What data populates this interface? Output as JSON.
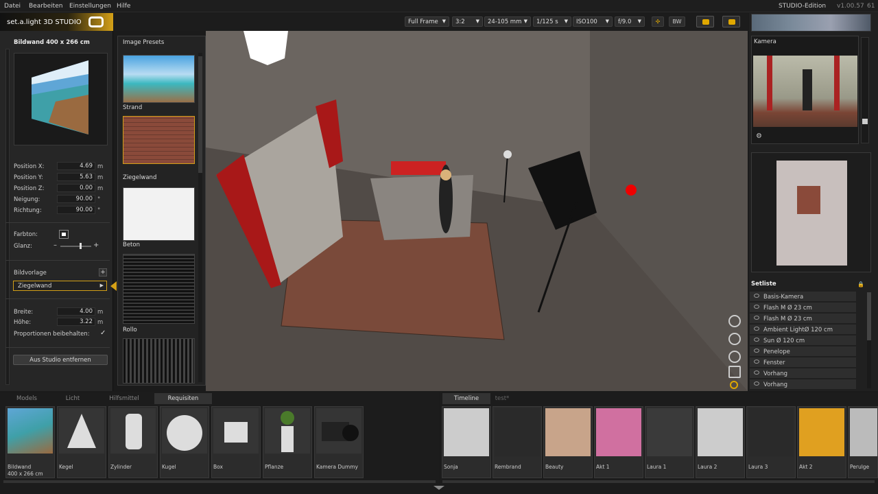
{
  "menu": {
    "items": [
      "Datei",
      "Bearbeiten",
      "Einstellungen",
      "Hilfe"
    ],
    "edition": "STUDIO-Edition",
    "version": "v1.00.57",
    "fps": "61"
  },
  "logo": {
    "text": "set.a.light 3D STUDIO"
  },
  "toolbar": {
    "frame": "Full Frame",
    "ratio": "3:2",
    "lens": "24-105 mm",
    "shutter": "1/125 s",
    "iso": "ISO100",
    "aperture": "f/9.0",
    "bw": "BW"
  },
  "left": {
    "title": "Bildwand 400 x 266 cm",
    "fields": [
      {
        "label": "Position X:",
        "value": "4.69",
        "unit": "m"
      },
      {
        "label": "Position Y:",
        "value": "5.63",
        "unit": "m"
      },
      {
        "label": "Position Z:",
        "value": "0.00",
        "unit": "m"
      },
      {
        "label": "Neigung:",
        "value": "90.00",
        "unit": "°"
      },
      {
        "label": "Richtung:",
        "value": "90.00",
        "unit": "°"
      }
    ],
    "farbton": "Farbton:",
    "glanz": "Glanz:",
    "bildvorlage": "Bildvorlage",
    "bildvorlage_value": "Ziegelwand",
    "breite_label": "Breite:",
    "breite": "4.00",
    "hoehe_label": "Höhe:",
    "hoehe": "3.22",
    "unit": "m",
    "proportionen": "Proportionen beibehalten:",
    "remove": "Aus Studio entfernen"
  },
  "presets": {
    "title": "Image Presets",
    "items": [
      "Strand",
      "Ziegelwand",
      "Beton",
      "Rollo"
    ]
  },
  "right": {
    "kamera": "Kamera",
    "setliste_title": "Setliste",
    "setliste": [
      "Basis-Kamera",
      "Flash M Ø 23 cm",
      "Flash M Ø 23 cm",
      "Ambient LightØ 120 cm",
      "Sun Ø 120 cm",
      "Penelope",
      "Fenster",
      "Vorhang",
      "Vorhang"
    ]
  },
  "bottom": {
    "tabs": [
      "Models",
      "Licht",
      "Hilfsmittel",
      "Requisiten"
    ],
    "items": [
      {
        "l1": "Bildwand",
        "l2": "400 x 266 cm"
      },
      {
        "l1": "Kegel",
        "l2": ""
      },
      {
        "l1": "Zylinder",
        "l2": ""
      },
      {
        "l1": "Kugel",
        "l2": ""
      },
      {
        "l1": "Box",
        "l2": ""
      },
      {
        "l1": "Pflanze",
        "l2": ""
      },
      {
        "l1": "Kamera Dummy",
        "l2": ""
      }
    ],
    "timeline_tab": "Timeline",
    "timeline_tab2": "test*",
    "timeline": [
      "Sonja",
      "Rembrand",
      "Beauty",
      "Akt 1",
      "Laura 1",
      "Laura 2",
      "Laura 3",
      "Akt 2",
      "Perulge"
    ]
  }
}
